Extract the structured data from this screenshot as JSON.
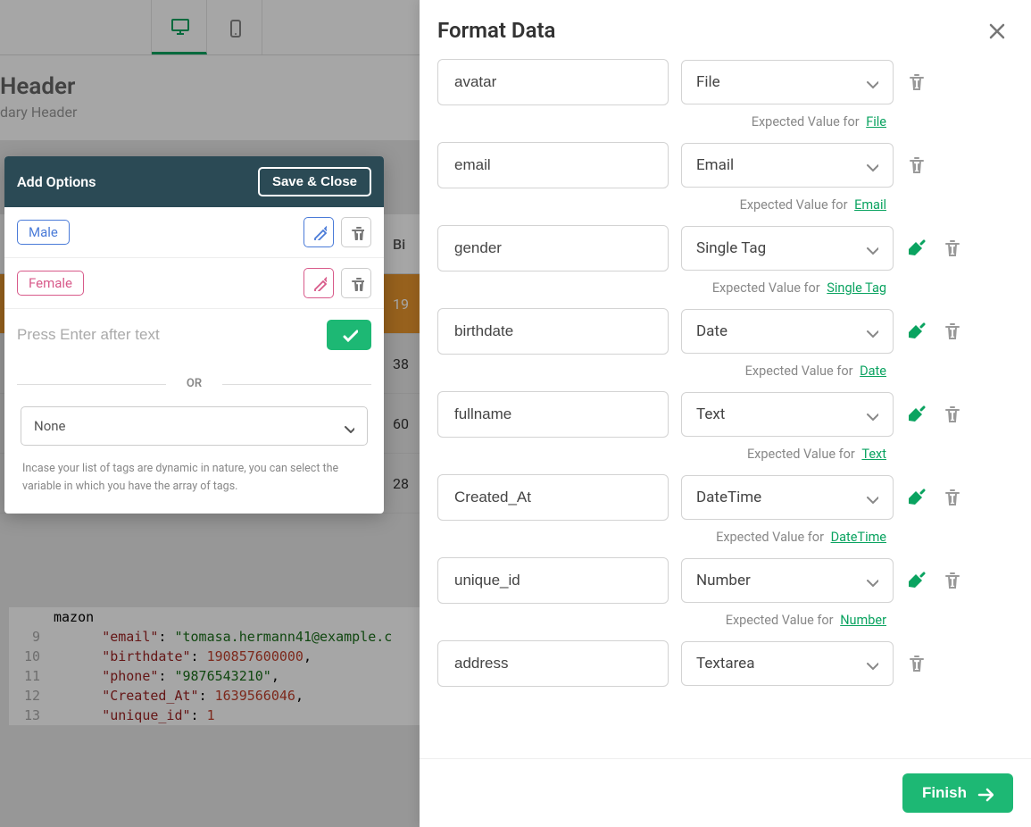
{
  "background": {
    "header_title": "Header",
    "header_sub": "dary Header",
    "table": {
      "header": "Bi",
      "rows": [
        "19",
        "38",
        "60",
        "28"
      ]
    },
    "code_lines": [
      {
        "n": "",
        "parts": [
          [
            "plain",
            "mazon"
          ]
        ]
      },
      {
        "n": "9",
        "parts": [
          [
            "plain",
            "      "
          ],
          [
            "key",
            "\"email\""
          ],
          [
            "plain",
            ": "
          ],
          [
            "str",
            "\"tomasa.hermann41@example.c"
          ]
        ]
      },
      {
        "n": "10",
        "parts": [
          [
            "plain",
            "      "
          ],
          [
            "key",
            "\"birthdate\""
          ],
          [
            "plain",
            ": "
          ],
          [
            "num",
            "190857600000"
          ],
          [
            "plain",
            ","
          ]
        ]
      },
      {
        "n": "11",
        "parts": [
          [
            "plain",
            "      "
          ],
          [
            "key",
            "\"phone\""
          ],
          [
            "plain",
            ": "
          ],
          [
            "str",
            "\"9876543210\""
          ],
          [
            "plain",
            ","
          ]
        ]
      },
      {
        "n": "12",
        "parts": [
          [
            "plain",
            "      "
          ],
          [
            "key",
            "\"Created_At\""
          ],
          [
            "plain",
            ": "
          ],
          [
            "num",
            "1639566046"
          ],
          [
            "plain",
            ","
          ]
        ]
      },
      {
        "n": "13",
        "parts": [
          [
            "plain",
            "      "
          ],
          [
            "key",
            "\"unique_id\""
          ],
          [
            "plain",
            ": "
          ],
          [
            "num",
            "1"
          ]
        ]
      }
    ]
  },
  "add_options": {
    "title": "Add Options",
    "save_label": "Save & Close",
    "tags": [
      {
        "label": "Male",
        "cls": "male"
      },
      {
        "label": "Female",
        "cls": "female"
      }
    ],
    "input_placeholder": "Press Enter after text",
    "or_label": "OR",
    "select_value": "None",
    "hint": "Incase your list of tags are dynamic in nature, you can select the variable in which you have the array of tags."
  },
  "format_panel": {
    "title": "Format Data",
    "expected_label": "Expected Value for",
    "fields": [
      {
        "name": "avatar",
        "type": "File",
        "paint": false
      },
      {
        "name": "email",
        "type": "Email",
        "paint": false
      },
      {
        "name": "gender",
        "type": "Single Tag",
        "paint": true
      },
      {
        "name": "birthdate",
        "type": "Date",
        "paint": true
      },
      {
        "name": "fullname",
        "type": "Text",
        "paint": true
      },
      {
        "name": "Created_At",
        "type": "DateTime",
        "paint": true
      },
      {
        "name": "unique_id",
        "type": "Number",
        "paint": true
      },
      {
        "name": "address",
        "type": "Textarea",
        "paint": false,
        "no_expected": true
      }
    ],
    "finish_label": "Finish"
  }
}
